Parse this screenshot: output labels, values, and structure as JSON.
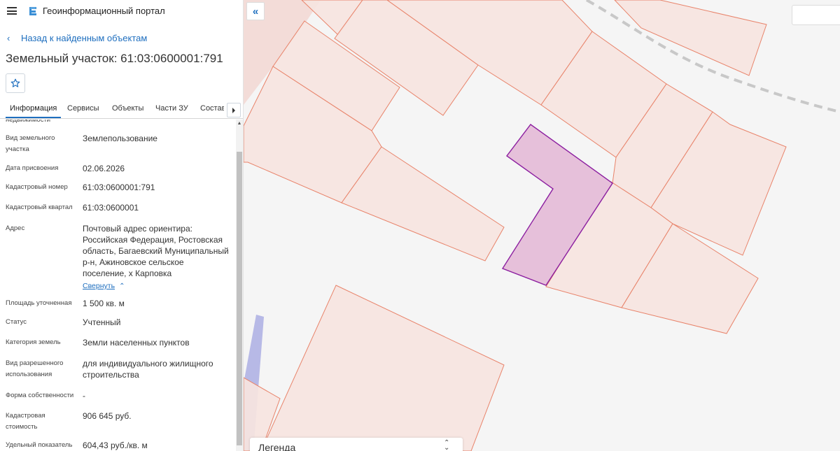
{
  "app": {
    "title": "Геоинформационный портал"
  },
  "nav": {
    "back_label": "Назад к найденным объектам"
  },
  "object": {
    "title": "Земельный участок: 61:03:0600001:791"
  },
  "tabs": [
    {
      "label": "Информация",
      "active": true
    },
    {
      "label": "Сервисы"
    },
    {
      "label": "Объекты"
    },
    {
      "label": "Части ЗУ"
    },
    {
      "label": "Состав"
    }
  ],
  "properties": {
    "partial_label": "недвижимости",
    "rows": [
      {
        "label": "Вид земельного участка",
        "value": "Землепользование"
      },
      {
        "label": "Дата присвоения",
        "value": "02.06.2026"
      },
      {
        "label": "Кадастровый номер",
        "value": "61:03:0600001:791"
      },
      {
        "label": "Кадастровый квартал",
        "value": "61:03:0600001"
      },
      {
        "label": "Адрес",
        "value": "Почтовый адрес ориентира: Российская Федерация, Ростовская область, Багаевский Муниципальный р-н, Ажиновское сельское поселение, х Карповка"
      },
      {
        "label": "Площадь уточненная",
        "value": "1 500 кв. м"
      },
      {
        "label": "Статус",
        "value": "Учтенный"
      },
      {
        "label": "Категория земель",
        "value": "Земли населенных пунктов"
      },
      {
        "label": "Вид разрешенного использования",
        "value": "для индивидуального жилищного строительства"
      },
      {
        "label": "Форма собственности",
        "value": "-"
      },
      {
        "label": "Кадастровая стоимость",
        "value": "906 645 руб."
      },
      {
        "label": "Удельный показатель",
        "value": "604,43 руб./кв. м"
      }
    ],
    "collapse_label": "Свернуть"
  },
  "legend": {
    "title": "Легенда"
  },
  "colors": {
    "accent": "#1f6fbf",
    "parcel_fill": "#f6e4e0",
    "parcel_stroke": "#e8836a",
    "selected_fill": "#e6c0da",
    "selected_stroke": "#8c1fa0",
    "water": "#b7b9e6"
  },
  "icons": {
    "menu": "hamburger-icon",
    "logo": "portal-logo-icon",
    "back": "chevron-left-icon",
    "favorite": "star-icon",
    "tabs_next": "chevron-right-icon",
    "collapse_panel": "double-chevron-left-icon",
    "legend_toggle": "chevron-updown-icon"
  }
}
